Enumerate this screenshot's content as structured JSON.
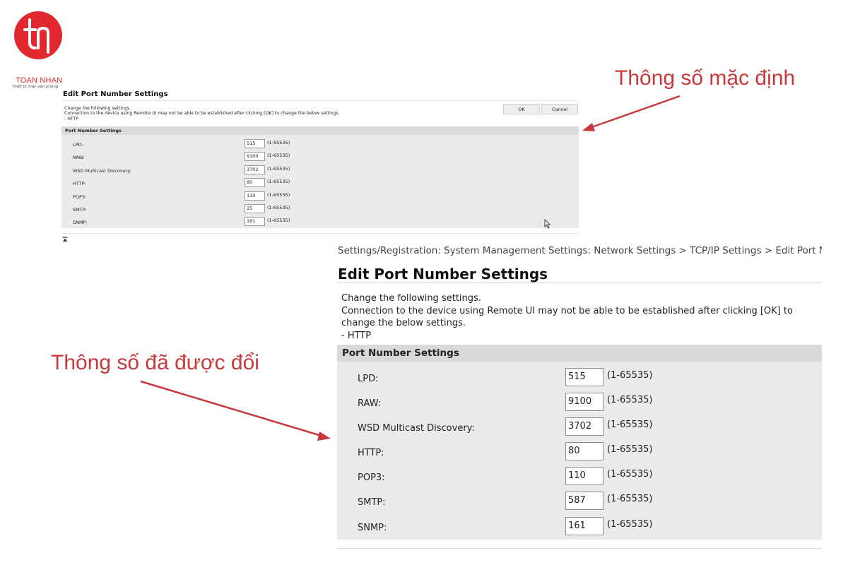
{
  "logo": {
    "name": "TOAN NHAN",
    "tagline": "Thiết bị máy văn phòng",
    "color": "#e0282e"
  },
  "annotations": {
    "default_label": "Thông số mặc định",
    "changed_label": "Thông số đã được đổi",
    "color": "#c8383c"
  },
  "default_screen": {
    "title": "Edit Port Number Settings",
    "description": [
      "Change the following settings.",
      "Connection to the device using Remote UI may not be able to be established after clicking [OK] to change the below settings.",
      "- HTTP"
    ],
    "ok_label": "OK",
    "cancel_label": "Cancel",
    "section_title": "Port Number Settings",
    "ports": [
      {
        "label": "LPD:",
        "value": "515",
        "range": "(1-65535)"
      },
      {
        "label": "RAW:",
        "value": "9100",
        "range": "(1-65535)"
      },
      {
        "label": "WSD Multicast Discovery:",
        "value": "3702",
        "range": "(1-65535)"
      },
      {
        "label": "HTTP:",
        "value": "80",
        "range": "(1-65535)"
      },
      {
        "label": "POP3:",
        "value": "110",
        "range": "(1-65535)"
      },
      {
        "label": "SMTP:",
        "value": "25",
        "range": "(1-65535)"
      },
      {
        "label": "SNMP:",
        "value": "161",
        "range": "(1-65535)"
      }
    ]
  },
  "changed_screen": {
    "breadcrumb": "Settings/Registration: System Management Settings: Network Settings > TCP/IP Settings > Edit Port Number Settings",
    "title": "Edit Port Number Settings",
    "description": [
      "Change the following settings.",
      "Connection to the device using Remote UI may not be able to be established after clicking [OK] to",
      "change the below settings.",
      "- HTTP"
    ],
    "section_title": "Port Number Settings",
    "ports": [
      {
        "label": "LPD:",
        "value": "515",
        "range": "(1-65535)"
      },
      {
        "label": "RAW:",
        "value": "9100",
        "range": "(1-65535)"
      },
      {
        "label": "WSD Multicast Discovery:",
        "value": "3702",
        "range": "(1-65535)"
      },
      {
        "label": "HTTP:",
        "value": "80",
        "range": "(1-65535)"
      },
      {
        "label": "POP3:",
        "value": "110",
        "range": "(1-65535)"
      },
      {
        "label": "SMTP:",
        "value": "587",
        "range": "(1-65535)"
      },
      {
        "label": "SNMP:",
        "value": "161",
        "range": "(1-65535)"
      }
    ]
  }
}
